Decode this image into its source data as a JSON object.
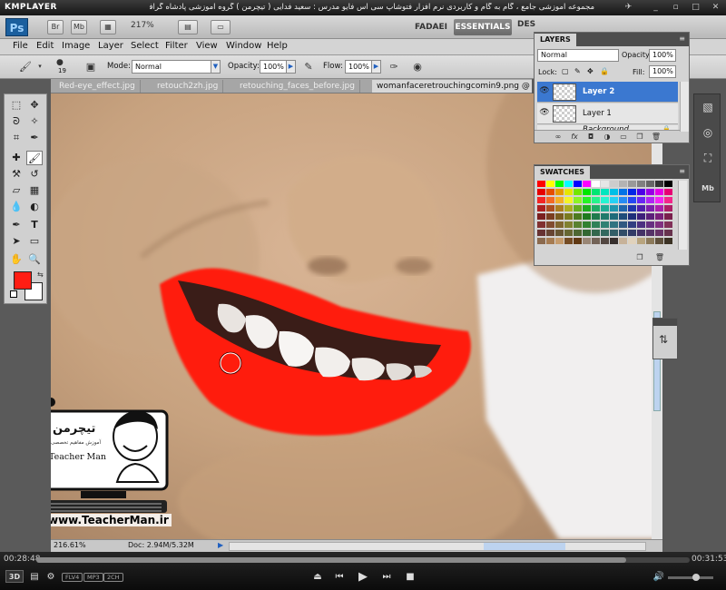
{
  "player": {
    "logo": "KMPLAYER",
    "title": "مجموعه آموزشی جامع ، گام به گام و کاربردی نرم افزار فتوشاپ سی اس فایو   مدرس : سعید فدایی ( تیچرمن ) گروه آموزشی پادشاه گرافیست ها",
    "elapsed": "00:28:48",
    "total": "00:31:53",
    "progress": 0.903,
    "badges": [
      "FLV4",
      "MP3",
      "2CH"
    ],
    "volume": 0.62,
    "label_3d": "3D"
  },
  "ps_appbar": {
    "logo": "Ps",
    "btn_br": "Br",
    "btn_mb": "Mb",
    "zoom": "217%",
    "workspaces": [
      "FADAEI",
      "ESSENTIALS",
      "DES"
    ]
  },
  "menu": [
    "File",
    "Edit",
    "Image",
    "Layer",
    "Select",
    "Filter",
    "View",
    "Window",
    "Help"
  ],
  "options": {
    "brush_size": "19",
    "mode_label": "Mode:",
    "mode_value": "Normal",
    "opacity_label": "Opacity:",
    "opacity_value": "100%",
    "flow_label": "Flow:",
    "flow_value": "100%"
  },
  "doc_tabs": [
    "Red-eye_effect.jpg",
    "retouch2zh.jpg",
    "retouching_faces_before.jpg",
    "womanfaceretrouchingcomin9.png @ 21"
  ],
  "colors": {
    "foreground": "#ff1d13",
    "background": "#ffffff",
    "lip_paint": "#ff1a0e",
    "selected_layer": "#3b78d0"
  },
  "layers": {
    "tab": "LAYERS",
    "blend_mode": "Normal",
    "opacity_label": "Opacity:",
    "opacity_value": "100%",
    "lock_label": "Lock:",
    "fill_label": "Fill:",
    "fill_value": "100%",
    "items": [
      {
        "name": "Layer 2",
        "selected": true
      },
      {
        "name": "Layer 1",
        "selected": false
      },
      {
        "name": "Background",
        "selected": false,
        "locked": true
      }
    ]
  },
  "swatches": {
    "tab": "SWATCHES"
  },
  "status": {
    "zoom": "216.61%",
    "doc": "Doc: 2.94M/5.32M"
  },
  "watermark": {
    "brand_fa": "تیچرمن",
    "subtitle_fa": "آموزش مفاهیم تخصصی",
    "brand_en": "Teacher Man",
    "url": "www.TeacherMan.ir"
  },
  "icons": {
    "eye": "eye-icon",
    "lock": "lock-icon",
    "brush": "brush-icon"
  }
}
